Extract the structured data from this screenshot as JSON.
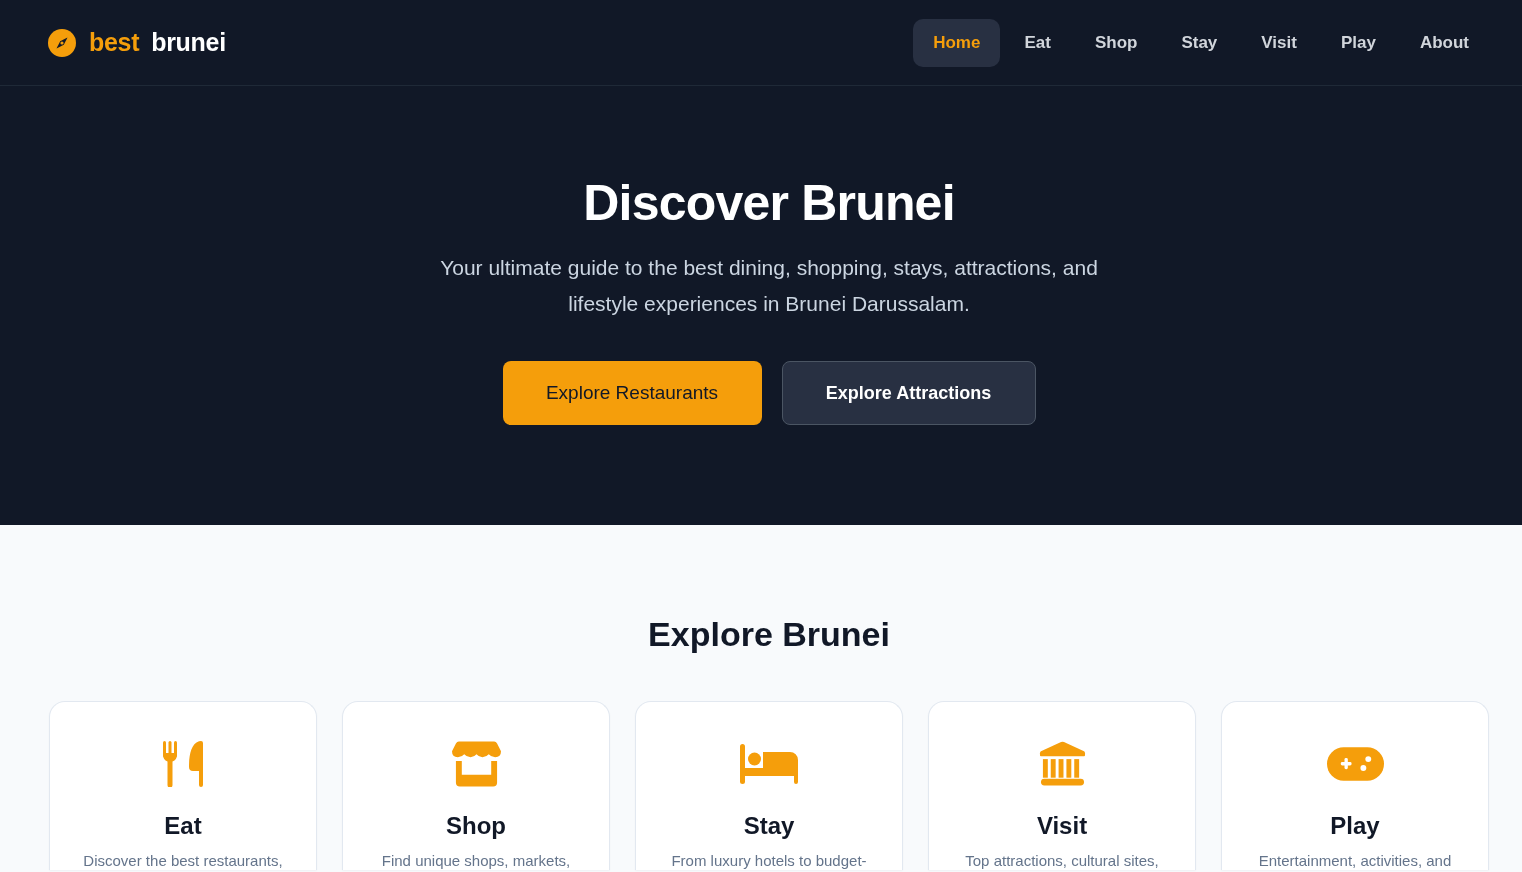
{
  "header": {
    "logo": {
      "prefix": "best",
      "name": "brunei"
    },
    "nav": [
      {
        "label": "Home",
        "selected": true
      },
      {
        "label": "Eat",
        "selected": false
      },
      {
        "label": "Shop",
        "selected": false
      },
      {
        "label": "Stay",
        "selected": false
      },
      {
        "label": "Visit",
        "selected": false
      },
      {
        "label": "Play",
        "selected": false
      },
      {
        "label": "About",
        "selected": false
      }
    ]
  },
  "hero": {
    "title": "Discover Brunei",
    "subtitle": "Your ultimate guide to the best dining, shopping, stays, attractions, and lifestyle experiences in Brunei Darussalam.",
    "buttons": [
      {
        "label": "Explore Restaurants",
        "kind": "primary"
      },
      {
        "label": "Explore Attractions",
        "kind": "secondary"
      }
    ]
  },
  "explore": {
    "title": "Explore Brunei",
    "cards": [
      {
        "kind": "eat",
        "title": "Eat",
        "description": "Discover the best restaurants,"
      },
      {
        "kind": "shop",
        "title": "Shop",
        "description": "Find unique shops, markets,"
      },
      {
        "kind": "stay",
        "title": "Stay",
        "description": "From luxury hotels to budget-"
      },
      {
        "kind": "visit",
        "title": "Visit",
        "description": "Top attractions, cultural sites,"
      },
      {
        "kind": "play",
        "title": "Play",
        "description": "Entertainment, activities, and"
      }
    ]
  }
}
